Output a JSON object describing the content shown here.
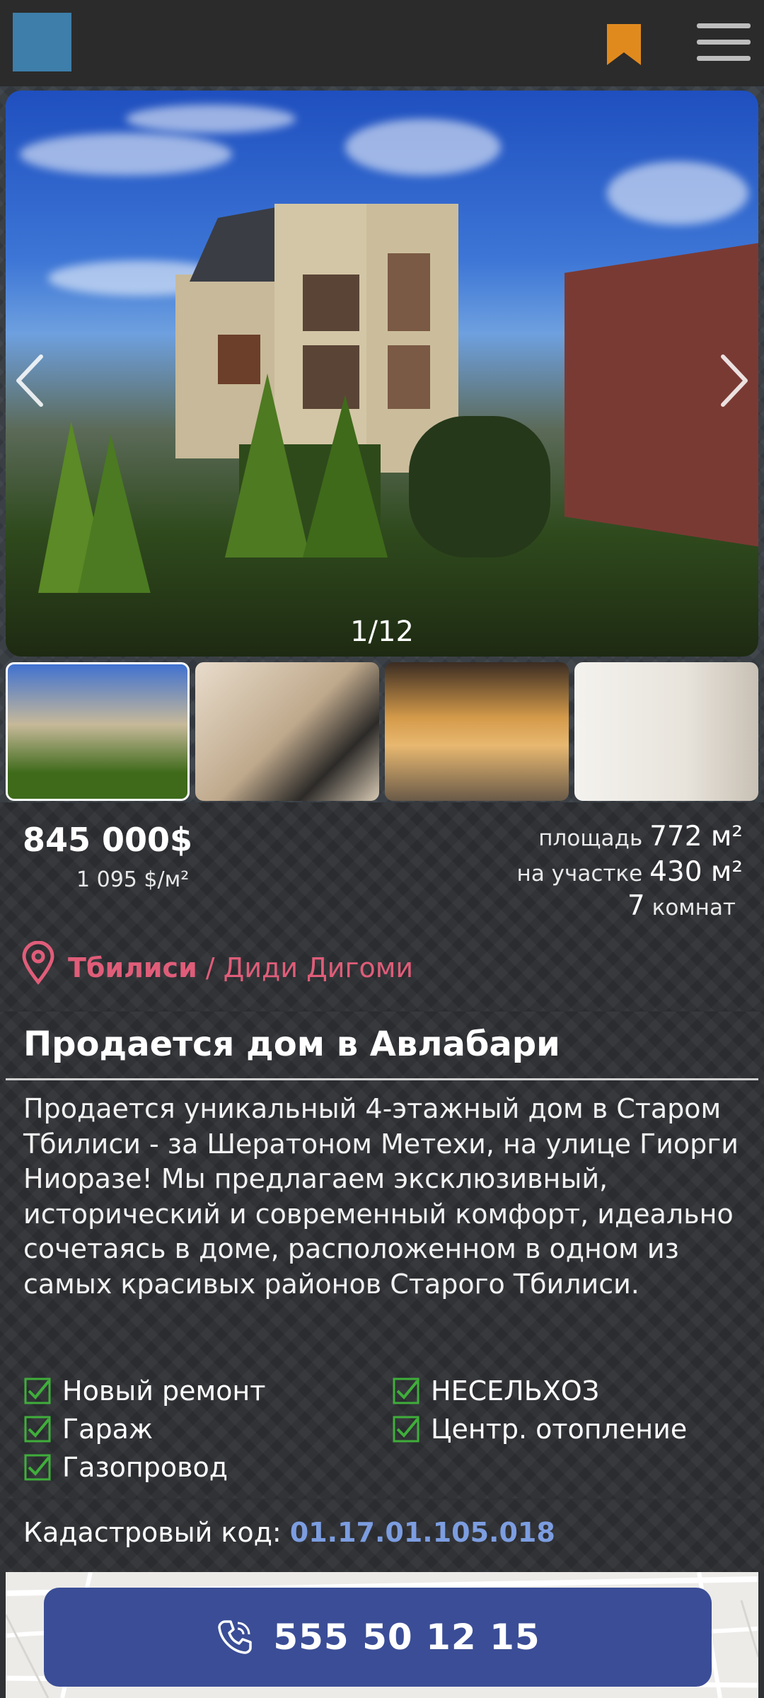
{
  "header": {
    "logo": "logo",
    "bookmark_icon": "bookmark-icon",
    "menu_icon": "hamburger-menu-icon"
  },
  "gallery": {
    "counter": "1/12",
    "current": 1,
    "total": 12
  },
  "listing": {
    "price": "845 000$",
    "price_per_m2": "1 095 $/м²",
    "area_label": "площадь",
    "area_value": "772 м²",
    "plot_label": "на участке",
    "plot_value": "430 м²",
    "rooms_value": "7",
    "rooms_label": "комнат",
    "city": "Тбилиси",
    "district": " / Диди Дигоми",
    "title": "Продается дом в Авлабари",
    "description": "Продается уникальный 4-этажный дом в Старом Тбилиси - за Шератоном Метехи, на улице Гиорги Ниоразе! Мы предлагаем эксклюзивный, исторический и современный комфорт, идеально сочетаясь в доме, расположенном в одном из самых красивых районов Старого Тбилиси.",
    "features": [
      "Новый ремонт",
      "НЕСЕЛЬХОЗ",
      "Гараж",
      "Центр. отопление",
      "Газопровод"
    ],
    "cadastral_label": "Кадастровый код: ",
    "cadastral_code": "01.17.01.105.018"
  },
  "call": {
    "phone": "555 50 12 15",
    "icon": "phone-icon"
  },
  "colors": {
    "accent": "#e05d79",
    "button": "#3a4d96",
    "bookmark": "#e08a1e",
    "code": "#7c9de0",
    "check": "#3fae3a"
  }
}
